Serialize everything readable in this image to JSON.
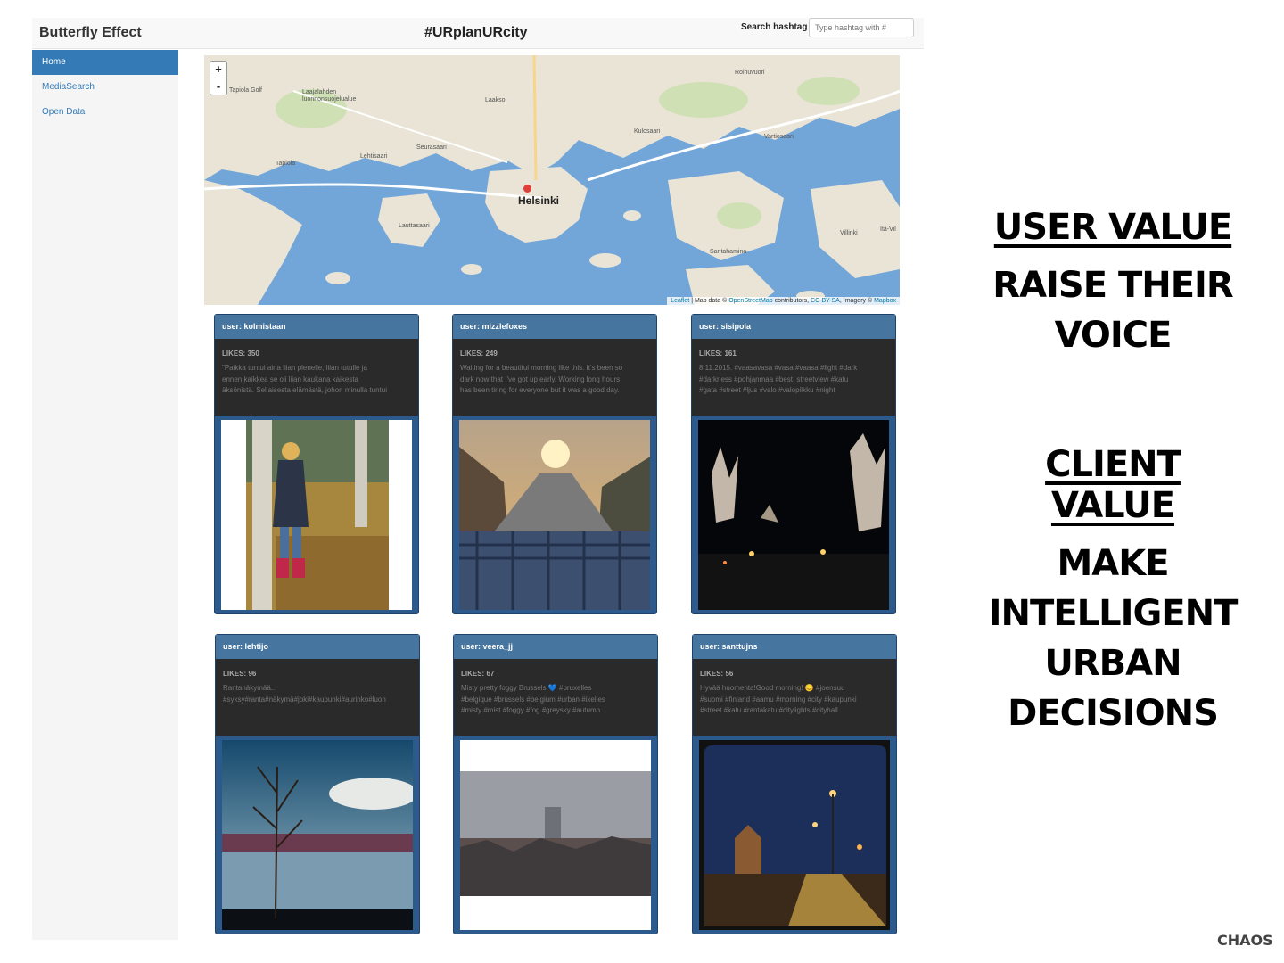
{
  "navbar": {
    "brand": "Butterfly Effect",
    "title": "#URplanURcity",
    "search_label": "Search hashtag",
    "search_placeholder": "Type hashtag with #"
  },
  "sidebar": {
    "items": [
      {
        "label": "Home",
        "active": true
      },
      {
        "label": "MediaSearch",
        "active": false
      },
      {
        "label": "Open Data",
        "active": false
      }
    ]
  },
  "map": {
    "zoom_in": "+",
    "zoom_out": "-",
    "city": "Helsinki",
    "places": [
      "Tapiola Golf",
      "Laajalahden luonnonsuojelualue",
      "Laakso",
      "Roihuvuori",
      "Kulosaari",
      "Vartiosaari",
      "Seurasaari",
      "Lehtisaari",
      "Tapiola",
      "Lauttasaari",
      "Santahamina",
      "Villinki",
      "Itä-Vil"
    ],
    "attribution": {
      "leaflet": "Leaflet",
      "text1": " | Map data © ",
      "osm": "OpenStreetMap",
      "text2": " contributors, ",
      "license": "CC-BY-SA",
      "text3": ", Imagery © ",
      "mapbox": "Mapbox"
    }
  },
  "posts": [
    {
      "user": "user: kolmistaan",
      "likes": "LIKES: 350",
      "caption": "\"Paikka tuntui aina liian pienelle, liian tutulle ja\nennen kaikkea se oli liian kaukana kaikesta\näksönistä. Sellaisesta elämästä, johon minulla tuntui"
    },
    {
      "user": "user: mizzlefoxes",
      "likes": "LIKES: 249",
      "caption": "Waiting for a beautiful morning like this. It's been so\ndark now that I've got up early. Working long hours\nhas been tiring for everyone but it was a good day."
    },
    {
      "user": "user: sisipola",
      "likes": "LIKES: 161",
      "caption": "8.11.2015. #vaasavasa #vasa #vaasa #light #dark\n#darkness #pohjanmaa #best_streetview #katu\n#gata #street #ljus #valo #valopilkku #night"
    },
    {
      "user": "user: lehtijo",
      "likes": "LIKES: 96",
      "caption": "Rantanäkymää..\n#syksy#ranta#näkymä#joki#kaupunki#aurinko#luon"
    },
    {
      "user": "user: veera_jj",
      "likes": "LIKES: 67",
      "caption": "Misty pretty foggy Brussels 💙 #bruxelles\n#belgique #brussels #belgium #urban #ixelles\n#misty #mist #foggy #fog #greysky #autumn"
    },
    {
      "user": "user: santtujns",
      "likes": "LIKES: 56",
      "caption": "Hyvää huomenta!Good morning! 😊 #joensuu\n#suomi #finland #aamu #morning #city #kaupunki\n#street #katu #rantakatu #citylights #cityhall"
    }
  ],
  "slide": {
    "user_value_heading": "USER VALUE",
    "user_value_lines": [
      "RAISE THEIR",
      "VOICE"
    ],
    "client_value_heading": "CLIENT VALUE",
    "client_value_lines": [
      "MAKE",
      "INTELLIGENT",
      "URBAN",
      "DECISIONS"
    ],
    "logo": "CHAOS"
  },
  "colors": {
    "nav_active": "#337ab7",
    "card_header": "#4676a0",
    "card_frame": "#2c5a8c",
    "water": "#72a6d8",
    "land": "#e9e4d6"
  }
}
